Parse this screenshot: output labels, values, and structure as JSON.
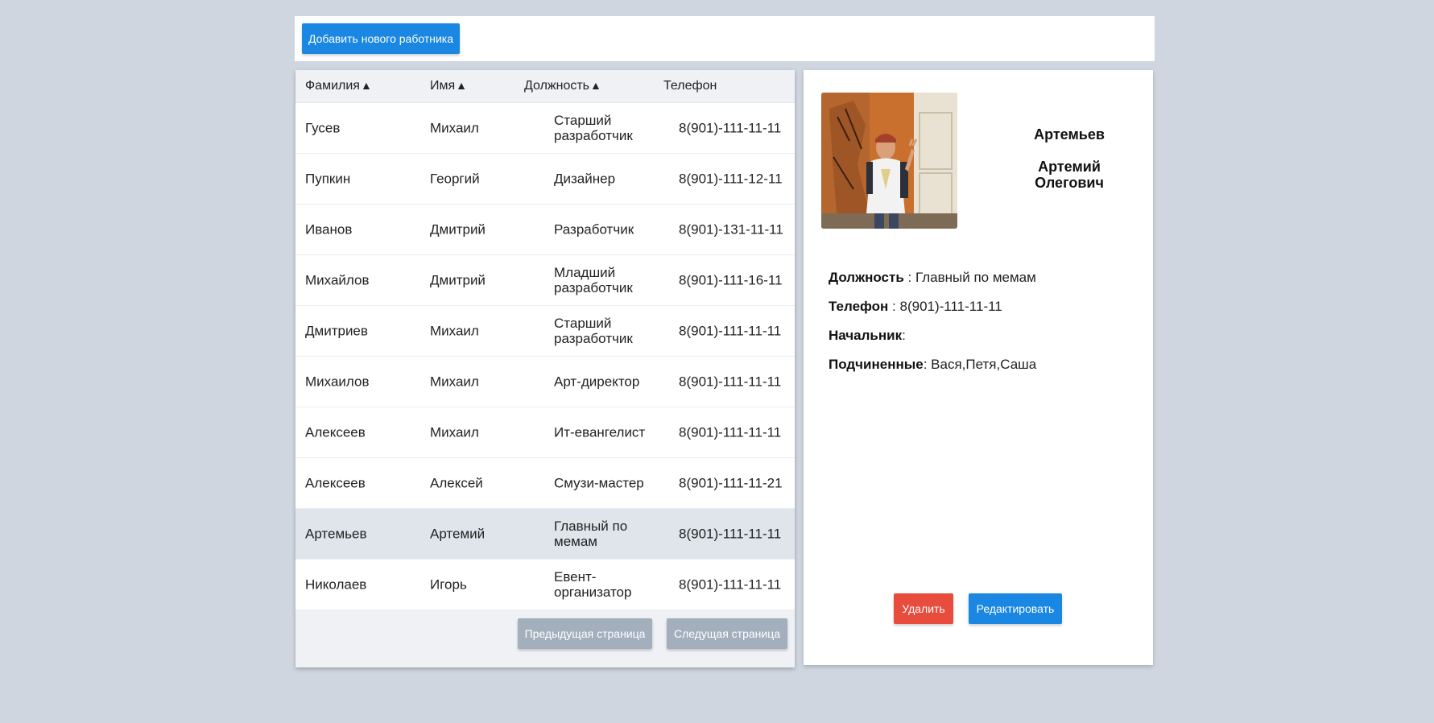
{
  "toolbar": {
    "add_label": "Добавить нового работника"
  },
  "table": {
    "headers": {
      "last": "Фамилия",
      "first": "Имя",
      "position": "Должность",
      "phone": "Телефон"
    },
    "sort_arrow": "▲",
    "rows": [
      {
        "last": "Гусев",
        "first": "Михаил",
        "position": "Старший разработчик",
        "phone": "8(901)-111-11-11"
      },
      {
        "last": "Пупкин",
        "first": "Георгий",
        "position": "Дизайнер",
        "phone": "8(901)-111-12-11"
      },
      {
        "last": "Иванов",
        "first": "Дмитрий",
        "position": "Разработчик",
        "phone": "8(901)-131-11-11"
      },
      {
        "last": "Михайлов",
        "first": "Дмитрий",
        "position": "Младший разработчик",
        "phone": "8(901)-111-16-11"
      },
      {
        "last": "Дмитриев",
        "first": "Михаил",
        "position": "Старший разработчик",
        "phone": "8(901)-111-11-11"
      },
      {
        "last": "Михаилов",
        "first": "Михаил",
        "position": "Арт-директор",
        "phone": "8(901)-111-11-11"
      },
      {
        "last": "Алексеев",
        "first": "Михаил",
        "position": "Ит-евангелист",
        "phone": "8(901)-111-11-11"
      },
      {
        "last": "Алексеев",
        "first": "Алексей",
        "position": "Смузи-мастер",
        "phone": "8(901)-111-11-21"
      },
      {
        "last": "Артемьев",
        "first": "Артемий",
        "position": "Главный по мемам",
        "phone": "8(901)-111-11-11",
        "selected": true
      },
      {
        "last": "Николаев",
        "first": "Игорь",
        "position": "Евент-организатор",
        "phone": "8(901)-111-11-11"
      }
    ],
    "prev_label": "Предыдущая страница",
    "next_label": "Следущая страница"
  },
  "detail": {
    "surname": "Артемьев",
    "given": "Артемий Олегович",
    "position_label": "Должность",
    "position_value": " : Главный по мемам",
    "phone_label": "Телефон",
    "phone_value": " : 8(901)-111-11-11",
    "boss_label": "Начальник",
    "boss_value": ":",
    "subs_label": "Подчиненные",
    "subs_value": ": Вася,Петя,Саша",
    "delete_label": "Удалить",
    "edit_label": "Редактировать"
  },
  "colors": {
    "background": "#cfd6df",
    "primary": "#1a87e2",
    "danger": "#e74c3c",
    "muted": "#a3afbc",
    "selected_row": "#dfe5ea"
  }
}
